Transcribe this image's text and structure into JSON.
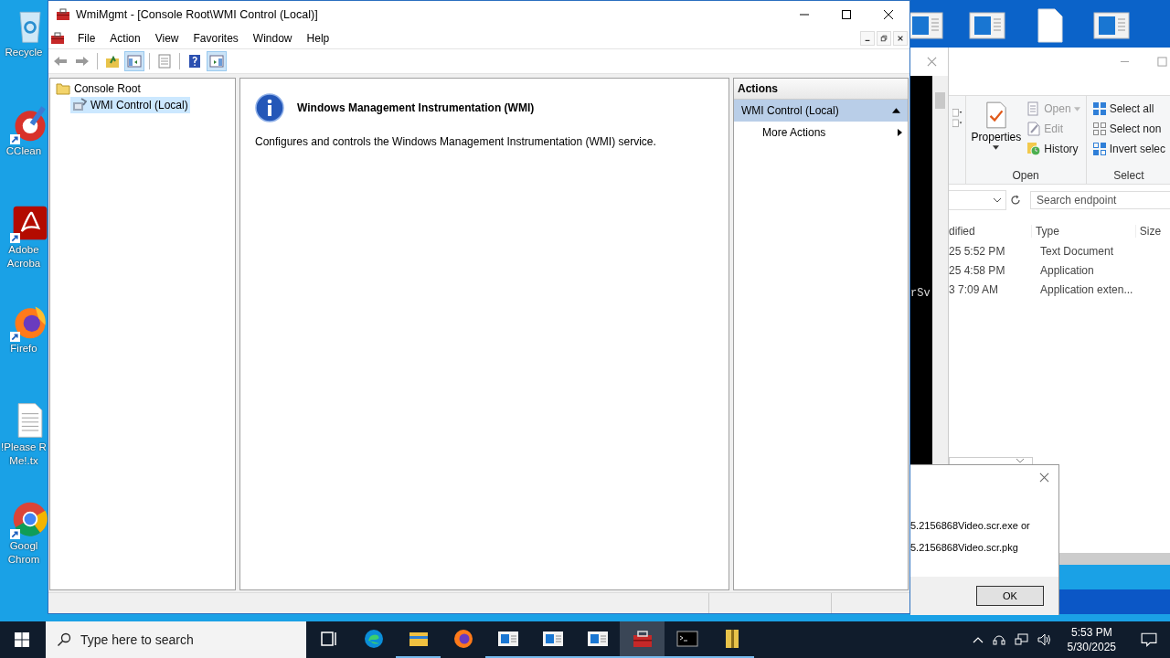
{
  "desktop_icons": [
    {
      "kind": "recycle-bin",
      "shortcut": false,
      "lines": [
        "Recycle"
      ]
    },
    {
      "kind": "ccleaner",
      "shortcut": true,
      "lines": [
        "CClean"
      ]
    },
    {
      "kind": "acrobat",
      "shortcut": true,
      "lines": [
        "Adobe",
        "Acroba"
      ]
    },
    {
      "kind": "firefox",
      "shortcut": true,
      "lines": [
        "Firefo"
      ]
    },
    {
      "kind": "text-file",
      "shortcut": false,
      "lines": [
        "!Please R",
        "Me!.tx"
      ]
    },
    {
      "kind": "chrome",
      "shortcut": true,
      "lines": [
        "Googl",
        "Chrom"
      ]
    }
  ],
  "background_icons": [
    {
      "kind": "window"
    },
    {
      "kind": "window"
    },
    {
      "kind": "document"
    },
    {
      "kind": "window"
    }
  ],
  "console_window": {
    "text": "rSv"
  },
  "explorer": {
    "ribbon": {
      "groups": [
        {
          "label": "Open",
          "big": {
            "label": "Properties"
          },
          "items": [
            {
              "kind": "open",
              "label": "Open",
              "disabled": true,
              "dropdown": true
            },
            {
              "kind": "edit",
              "label": "Edit",
              "disabled": true,
              "dropdown": false
            },
            {
              "kind": "history",
              "label": "History",
              "disabled": false,
              "dropdown": false
            }
          ]
        },
        {
          "label": "Select",
          "items": [
            {
              "kind": "select-all",
              "label": "Select all",
              "disabled": false,
              "dropdown": false
            },
            {
              "kind": "select-none",
              "label": "Select non",
              "disabled": false,
              "dropdown": false
            },
            {
              "kind": "invert",
              "label": "Invert selec",
              "disabled": false,
              "dropdown": false
            }
          ]
        }
      ]
    },
    "search": {
      "placeholder": "Search endpoint"
    },
    "columns": [
      "dified",
      "Type",
      "Size"
    ],
    "rows": [
      {
        "modified": "25 5:52 PM",
        "type": "Text Document"
      },
      {
        "modified": "25 4:58 PM",
        "type": "Application"
      },
      {
        "modified": "3 7:09 AM",
        "type": "Application exten..."
      }
    ]
  },
  "dialog": {
    "lines": [
      "5.2156868Video.scr.exe or",
      "5.2156868Video.scr.pkg"
    ],
    "button": "OK"
  },
  "window": {
    "title": "WmiMgmt - [Console Root\\WMI Control (Local)]",
    "menu": [
      "File",
      "Action",
      "View",
      "Favorites",
      "Window",
      "Help"
    ],
    "toolbar": [
      [
        {
          "kind": "back",
          "selected": false
        },
        {
          "kind": "forward",
          "selected": false
        }
      ],
      [
        {
          "kind": "up-folder",
          "selected": false
        },
        {
          "kind": "console-tree",
          "selected": true
        }
      ],
      [
        {
          "kind": "export-list",
          "selected": false
        }
      ],
      [
        {
          "kind": "help",
          "selected": false
        },
        {
          "kind": "action-pane",
          "selected": true
        }
      ]
    ],
    "tree": [
      {
        "label": "Console Root",
        "kind": "folder",
        "selected": false,
        "children": [
          {
            "label": "WMI Control (Local)",
            "kind": "wmi",
            "selected": true
          }
        ]
      }
    ],
    "content": {
      "heading": "Windows Management Instrumentation (WMI)",
      "description": "Configures and controls the Windows Management Instrumentation (WMI) service."
    },
    "actions": {
      "header": "Actions",
      "section": {
        "label": "WMI Control (Local)",
        "expanded": true
      },
      "items": [
        {
          "label": "More Actions",
          "submenu": true
        }
      ]
    }
  },
  "taskbar": {
    "search": {
      "placeholder": "Type here to search"
    },
    "apps": [
      {
        "kind": "task-view",
        "running": false,
        "selected": false
      },
      {
        "kind": "edge",
        "running": false,
        "selected": false
      },
      {
        "kind": "explorer",
        "running": true,
        "selected": false
      },
      {
        "kind": "firefox",
        "running": false,
        "selected": false
      },
      {
        "kind": "window",
        "running": true,
        "selected": false
      },
      {
        "kind": "window",
        "running": true,
        "selected": false
      },
      {
        "kind": "window",
        "running": true,
        "selected": false
      },
      {
        "kind": "mmc",
        "running": true,
        "selected": true
      },
      {
        "kind": "terminal",
        "running": true,
        "selected": false
      },
      {
        "kind": "archive",
        "running": true,
        "selected": false
      }
    ],
    "time": "5:53 PM",
    "date": "5/30/2025"
  }
}
